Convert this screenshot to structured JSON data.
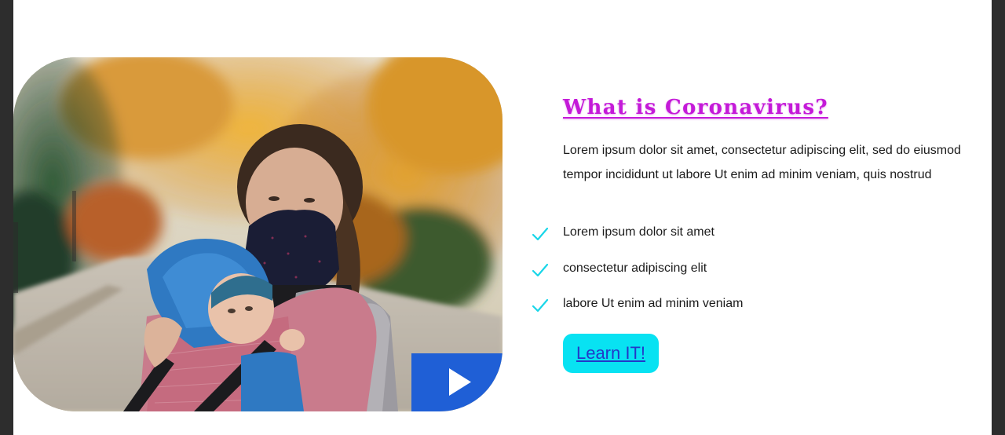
{
  "section": {
    "heading": "What is Coronavirus?",
    "paragraph": "Lorem ipsum dolor sit amet, consectetur adipiscing elit, sed do eiusmod tempor incididunt ut labore Ut enim ad minim veniam, quis nostrud",
    "checklist": [
      {
        "label": "Lorem ipsum dolor sit amet",
        "icon": "check-icon"
      },
      {
        "label": "consectetur adipiscing elit",
        "icon": "check-icon"
      },
      {
        "label": "labore Ut enim ad minim veniam",
        "icon": "check-icon"
      }
    ],
    "cta_label": "Learn IT!"
  },
  "media": {
    "image_subject": "woman wearing a face mask carrying a baby in a carrier, autumn trees",
    "play_icon": "play-icon"
  },
  "colors": {
    "heading": "#c41ad8",
    "check": "#19d6e8",
    "cta_background": "#08e2f2",
    "cta_text": "#2338c8",
    "play_background": "#1f5fd6"
  }
}
